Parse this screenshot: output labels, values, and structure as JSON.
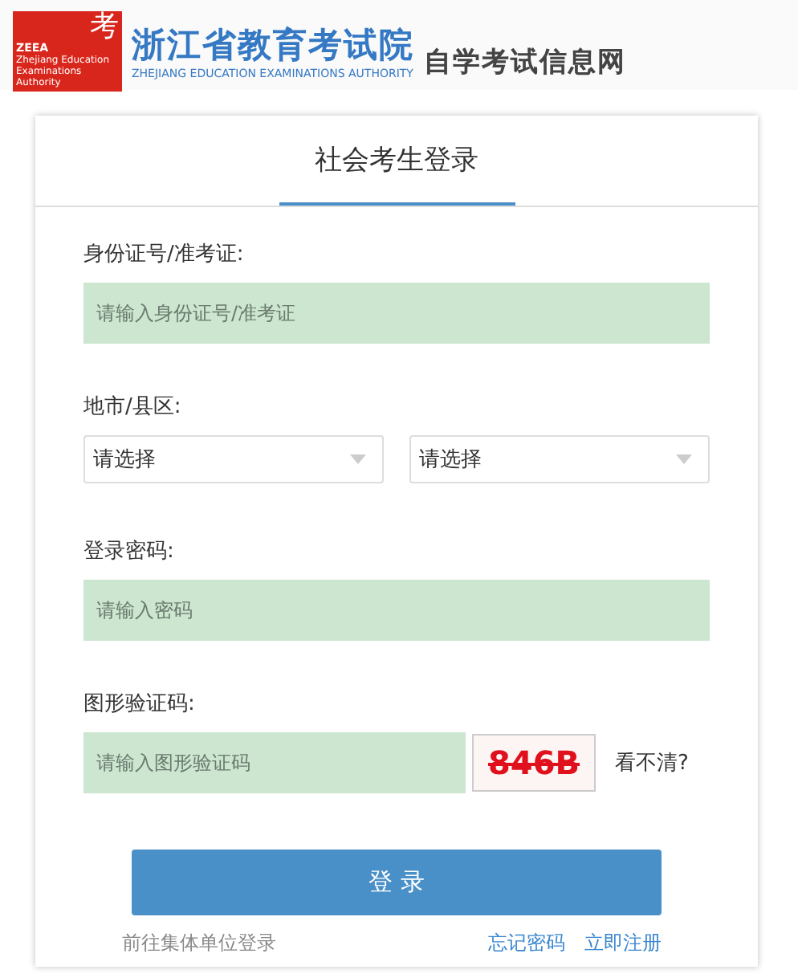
{
  "header": {
    "logo_mark": "考",
    "logo_abbr": "ZEEA",
    "logo_small": "Zhejiang Education Examinations Authority",
    "title": "浙江省教育考试院",
    "subtitle": "ZHEJIANG EDUCATION EXAMINATIONS AUTHORITY",
    "site_name": "自学考试信息网"
  },
  "tabs": [
    {
      "label": "社会考生登录",
      "selected": true
    }
  ],
  "form": {
    "id_label": "身份证号/准考证:",
    "id_field": {
      "placeholder": "请输入身份证号/准考证"
    },
    "region_label": "地市/县区:",
    "selects": [
      {
        "value": "请选择"
      },
      {
        "value": "请选择"
      }
    ],
    "password_label": "登录密码:",
    "password_field": {
      "placeholder": "请输入密码"
    },
    "captcha_label": "图形验证码:",
    "captcha_field": {
      "placeholder": "请输入图形验证码"
    },
    "captcha_text": "846B",
    "refresh_link": "看不清?"
  },
  "login_button": "登 录",
  "links": {
    "group_login": "前往集体单位登录",
    "forgot": "忘记密码",
    "register": "立即注册"
  }
}
